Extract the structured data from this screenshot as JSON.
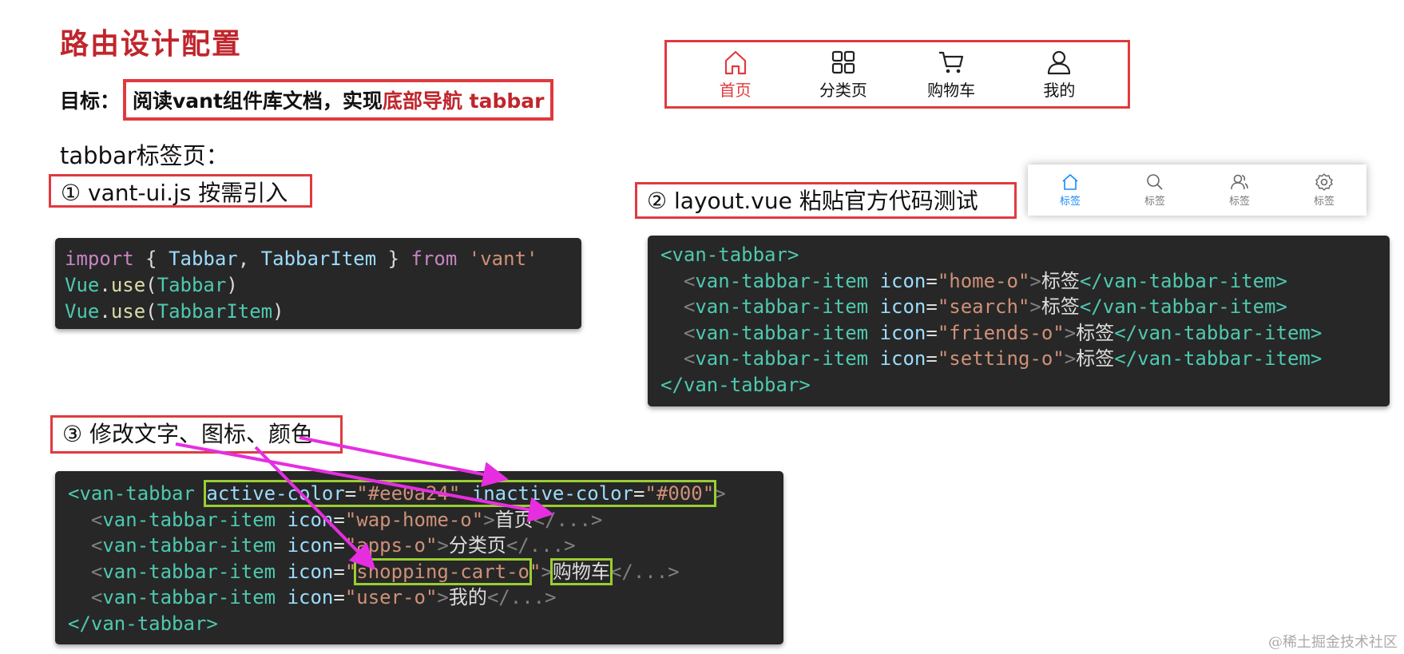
{
  "title": "路由设计配置",
  "goal": {
    "prefix": "目标：",
    "text_plain": "阅读vant组件库文档，实现",
    "text_highlight": "底部导航 tabbar"
  },
  "subtitle": "tabbar标签页：",
  "steps": {
    "step1": "① vant-ui.js 按需引入",
    "step2": "② layout.vue 粘贴官方代码测试",
    "step3": "③ 修改文字、图标、颜色"
  },
  "tabbar_custom": {
    "items": [
      {
        "label": "首页",
        "icon": "home-icon",
        "active": true
      },
      {
        "label": "分类页",
        "icon": "apps-icon",
        "active": false
      },
      {
        "label": "购物车",
        "icon": "shopping-cart-icon",
        "active": false
      },
      {
        "label": "我的",
        "icon": "user-icon",
        "active": false
      }
    ],
    "active_color": "#e03a3e"
  },
  "tabbar_demo": {
    "items": [
      {
        "label": "标签",
        "icon": "home-icon",
        "active": true
      },
      {
        "label": "标签",
        "icon": "search-icon",
        "active": false
      },
      {
        "label": "标签",
        "icon": "friends-icon",
        "active": false
      },
      {
        "label": "标签",
        "icon": "setting-icon",
        "active": false
      }
    ],
    "active_color": "#1989fa"
  },
  "code1": {
    "l1_import": "import",
    "l1_open": " { ",
    "l1_tabbar": "Tabbar",
    "l1_comma": ", ",
    "l1_item": "TabbarItem",
    "l1_close": " } ",
    "l1_from": "from",
    "l1_space": " ",
    "l1_mod": "'vant'",
    "l2_vue": "Vue",
    "l2_dot": ".",
    "l2_use": "use",
    "l2_arg": "Tabbar",
    "l3_arg": "TabbarItem"
  },
  "code2": {
    "open": "<van-tabbar>",
    "item_tag": "van-tabbar-item",
    "attr": "icon",
    "icons": [
      "\"home-o\"",
      "\"search\"",
      "\"friends-o\"",
      "\"setting-o\""
    ],
    "label": "标签",
    "close_item": "</van-tabbar-item>",
    "close": "</van-tabbar>"
  },
  "code3": {
    "open_tag": "<van-tabbar",
    "attr1_name": "active-color",
    "attr1_value": "\"#ee0a24\"",
    "attr2_name": "inactive-color",
    "attr2_value": "\"#000\"",
    "item_tag": "van-tabbar-item",
    "attr": "icon",
    "rows": [
      {
        "icon": "\"wap-home-o\"",
        "label": "首页"
      },
      {
        "icon": "\"apps-o\"",
        "label": "分类页"
      },
      {
        "icon": "\"shopping-cart-o\"",
        "label": "购物车"
      },
      {
        "icon": "\"user-o\"",
        "label": "我的"
      }
    ],
    "ellipsis": "</...>",
    "close": "</van-tabbar>"
  },
  "watermark": "@稀土掘金技术社区"
}
